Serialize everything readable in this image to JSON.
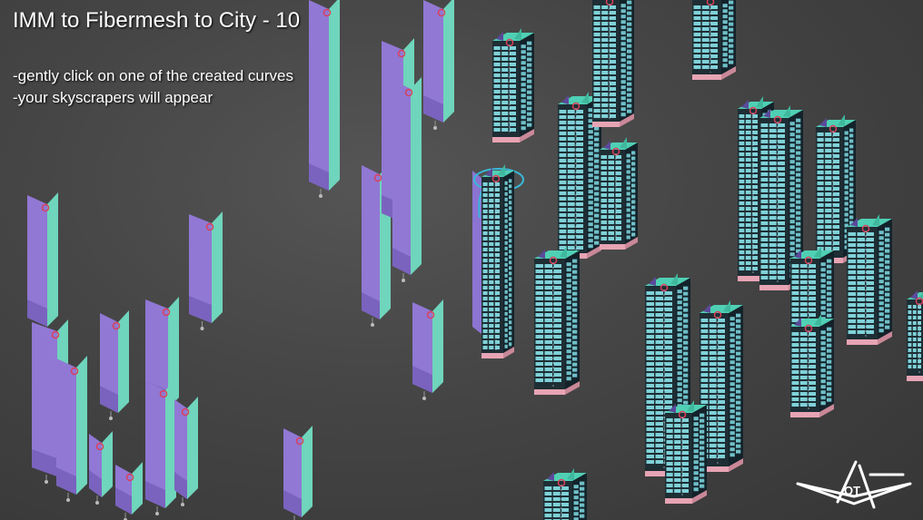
{
  "title": "IMM to Fibermesh to City - 10",
  "instructions": [
    "-gently click on one of the created curves",
    "-your skyscrapers will appear"
  ],
  "logo": {
    "text": "QT",
    "icon": "signature-logo-icon"
  },
  "colors": {
    "background": "#474747",
    "fiber_front": "#9178D4",
    "fiber_side": "#6FD5BC",
    "building_window": "#7FD1D8",
    "building_frame": "#1E2E34",
    "building_base": "#E7A4B4",
    "building_roof": "#4FD0B4",
    "curve_marker": "#D9405A",
    "selection_ring": "#39B8D8"
  }
}
